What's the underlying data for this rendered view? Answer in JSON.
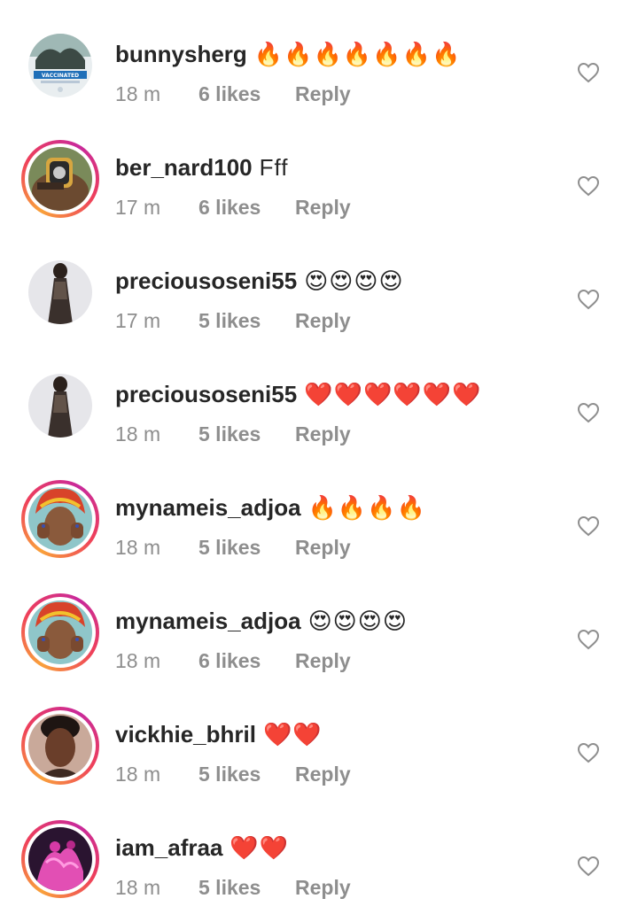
{
  "comments": [
    {
      "username": "bunnysherg",
      "text": "🔥🔥🔥🔥🔥🔥🔥",
      "time": "18 m",
      "likes": "6 likes",
      "reply": "Reply",
      "avatar_icon": "vaccinated-profile-avatar",
      "story_ring": false
    },
    {
      "username": "ber_nard100",
      "text": "Fff",
      "time": "17 m",
      "likes": "6 likes",
      "reply": "Reply",
      "avatar_icon": "wristwatch-profile-avatar",
      "story_ring": true
    },
    {
      "username": "preciousoseni55",
      "text": "😍😍😍😍",
      "time": "17 m",
      "likes": "5 likes",
      "reply": "Reply",
      "avatar_icon": "woman-lace-dress-avatar",
      "story_ring": false
    },
    {
      "username": "preciousoseni55",
      "text": "❤️❤️❤️❤️❤️❤️",
      "time": "18 m",
      "likes": "5 likes",
      "reply": "Reply",
      "avatar_icon": "woman-lace-dress-avatar",
      "story_ring": false
    },
    {
      "username": "mynameis_adjoa",
      "text": "🔥🔥🔥🔥",
      "time": "18 m",
      "likes": "5 likes",
      "reply": "Reply",
      "avatar_icon": "woman-headwrap-avatar",
      "story_ring": true
    },
    {
      "username": "mynameis_adjoa",
      "text": "😍😍😍😍",
      "time": "18 m",
      "likes": "6 likes",
      "reply": "Reply",
      "avatar_icon": "woman-headwrap-avatar",
      "story_ring": true
    },
    {
      "username": "vickhie_bhril",
      "text": "❤️❤️",
      "time": "18 m",
      "likes": "5 likes",
      "reply": "Reply",
      "avatar_icon": "woman-portrait-avatar",
      "story_ring": true
    },
    {
      "username": "iam_afraa",
      "text": "❤️❤️",
      "time": "18 m",
      "likes": "5 likes",
      "reply": "Reply",
      "avatar_icon": "pink-illustration-avatar",
      "story_ring": true
    }
  ],
  "icons": {
    "like": "heart-outline-icon"
  },
  "colors": {
    "text": "#262626",
    "meta": "#8e8e8e",
    "story_ring_start": "#f9a13b",
    "story_ring_end": "#c8299b"
  }
}
